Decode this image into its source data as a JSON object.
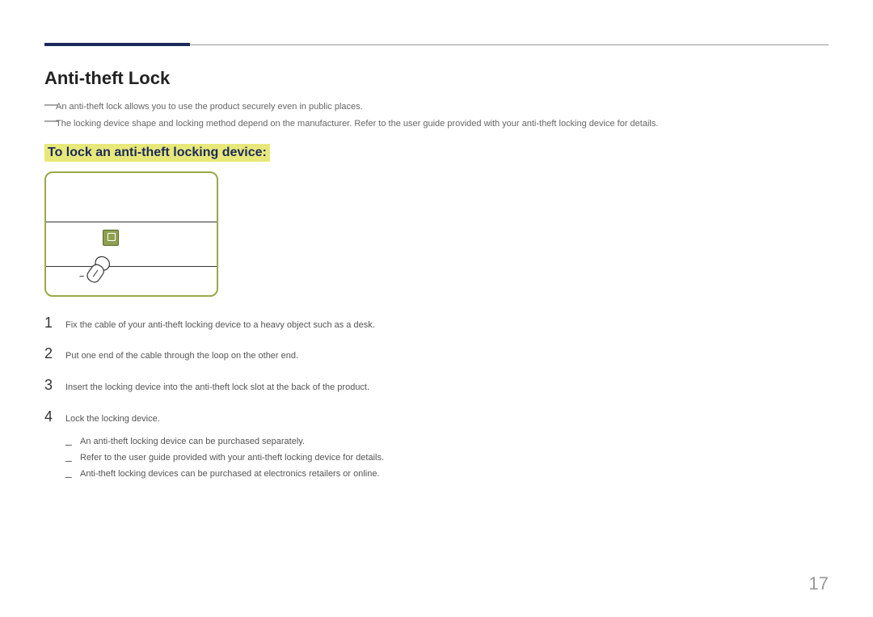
{
  "title": "Anti-theft Lock",
  "notes": [
    "An anti-theft lock allows you to use the product securely even in public places.",
    "The locking device shape and locking method depend on the manufacturer. Refer to the user guide provided with your anti-theft locking device for details."
  ],
  "subheading": "To lock an anti-theft locking device:",
  "steps": [
    {
      "num": "1",
      "text": "Fix the cable of your anti-theft locking device to a heavy object such as a desk."
    },
    {
      "num": "2",
      "text": "Put one end of the cable through the loop on the other end."
    },
    {
      "num": "3",
      "text": "Insert the locking device into the anti-theft lock slot at the back of the product."
    },
    {
      "num": "4",
      "text": "Lock the locking device."
    }
  ],
  "sub_bullets": [
    "An anti-theft locking device can be purchased separately.",
    "Refer to the user guide provided with your anti-theft locking device for details.",
    "Anti-theft locking devices can be purchased at electronics retailers or online."
  ],
  "page_number": "17"
}
